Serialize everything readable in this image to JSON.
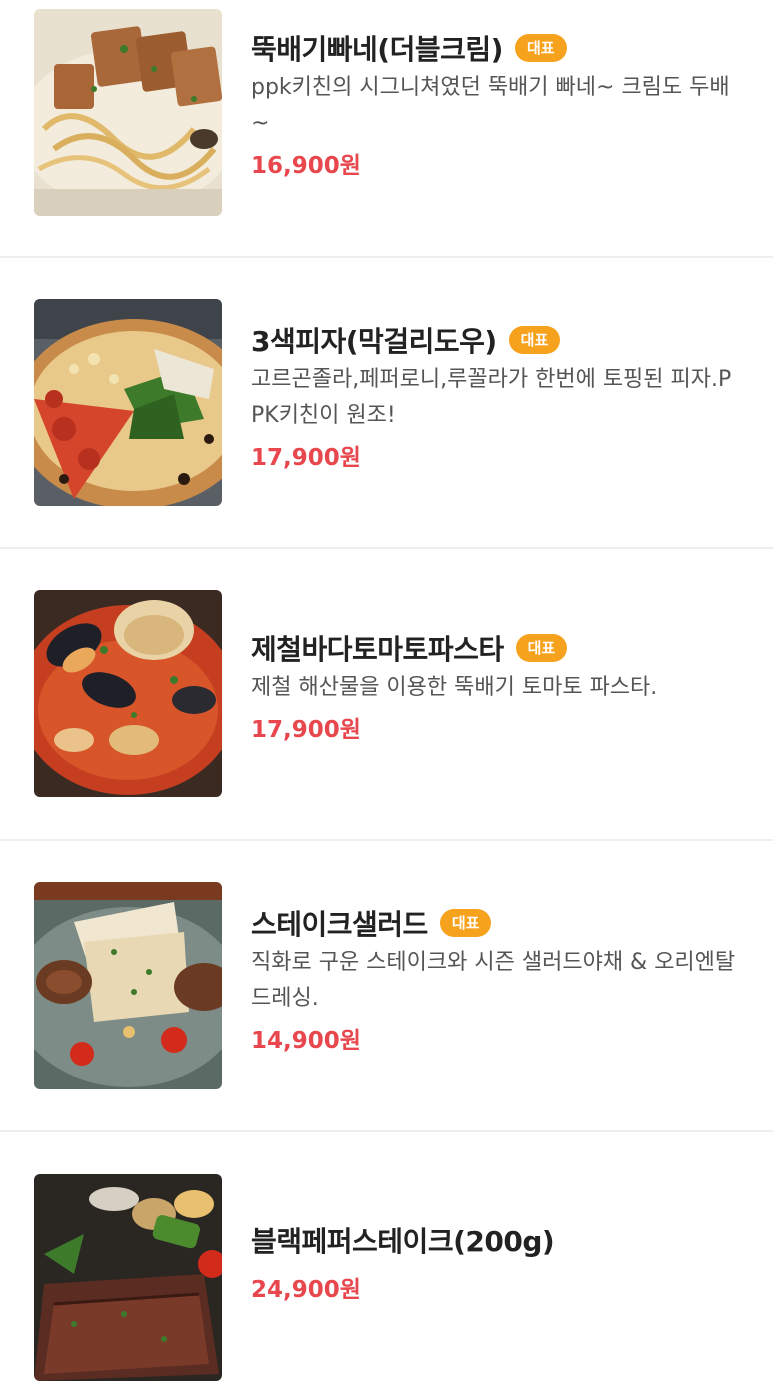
{
  "menu": {
    "badge_label": "대표",
    "items": [
      {
        "name": "뚝배기빠네(더블크림)",
        "badge": "대표",
        "description": "ppk키친의 시그니쳐였던 뚝배기 빠네~ 크림도 두배~",
        "price": "16,900원",
        "image_icon": "cream-pasta-photo"
      },
      {
        "name": "3색피자(막걸리도우)",
        "badge": "대표",
        "description": "고르곤졸라,페퍼로니,루꼴라가 한번에 토핑된 피자.PPK키친이 원조!",
        "price": "17,900원",
        "image_icon": "pizza-photo"
      },
      {
        "name": "제철바다토마토파스타",
        "badge": "대표",
        "description": "제철 해산물을 이용한 뚝배기 토마토 파스타.",
        "price": "17,900원",
        "image_icon": "seafood-pasta-photo"
      },
      {
        "name": "스테이크샐러드",
        "badge": "대표",
        "description": "직화로 구운 스테이크와 시즌 샐러드야채 & 오리엔탈 드레싱.",
        "price": "14,900원",
        "image_icon": "steak-salad-photo"
      },
      {
        "name": "블랙페퍼스테이크(200g)",
        "badge": "",
        "description": "",
        "price": "24,900원",
        "image_icon": "pepper-steak-photo"
      }
    ]
  },
  "colors": {
    "price": "#e8474d",
    "badge": "#f7a21c",
    "divider": "#eeeeee"
  }
}
